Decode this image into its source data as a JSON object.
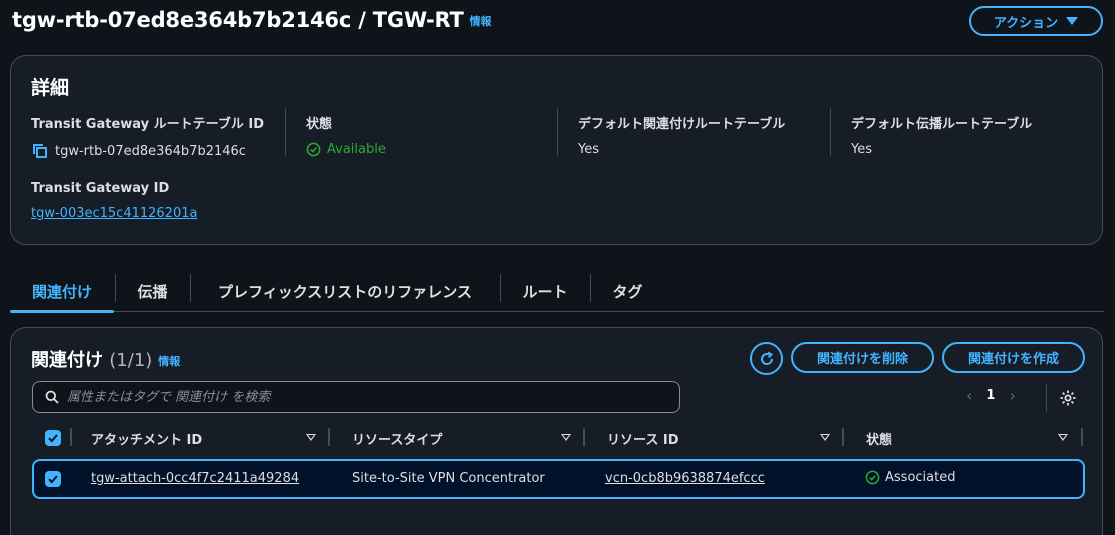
{
  "header": {
    "title": "tgw-rtb-07ed8e364b7b2146c / TGW-RT",
    "info_label": "情報",
    "actions_label": "アクション"
  },
  "details": {
    "title": "詳細",
    "fields": [
      {
        "label": "Transit Gateway ルートテーブル ID",
        "value": "tgw-rtb-07ed8e364b7b2146c"
      },
      {
        "label": "状態",
        "value": "Available"
      },
      {
        "label": "デフォルト関連付けルートテーブル",
        "value": "Yes"
      },
      {
        "label": "デフォルト伝播ルートテーブル",
        "value": "Yes"
      },
      {
        "label": "Transit Gateway ID",
        "value": "tgw-003ec15c41126201a"
      }
    ]
  },
  "tabs": [
    {
      "label": "関連付け",
      "active": true
    },
    {
      "label": "伝播"
    },
    {
      "label": "プレフィックスリストのリファレンス"
    },
    {
      "label": "ルート"
    },
    {
      "label": "タグ"
    }
  ],
  "associations": {
    "title": "関連付け",
    "count": "(1/1)",
    "info_label": "情報",
    "delete_label": "関連付けを削除",
    "create_label": "関連付けを作成",
    "search_placeholder": "属性またはタグで 関連付け を検索",
    "page_number": "1",
    "columns": [
      "アタッチメント ID",
      "リソースタイプ",
      "リソース ID",
      "状態"
    ],
    "rows": [
      {
        "attachment_id": "tgw-attach-0cc4f7c2411a49284",
        "resource_type": "Site-to-Site VPN Concentrator",
        "resource_id": "vcn-0cb8b9638874efccc",
        "state": "Associated",
        "selected": true
      }
    ]
  },
  "colors": {
    "accent": "#42b4ff",
    "success": "#29ad32",
    "background": "#0f141a",
    "panel": "#161d26"
  },
  "icons": [
    "copy-icon",
    "status-ok-icon",
    "caret-down-icon",
    "refresh-icon",
    "search-icon",
    "chevron-left-icon",
    "chevron-right-icon",
    "settings-icon",
    "checkbox-checked-icon",
    "sort-icon"
  ]
}
